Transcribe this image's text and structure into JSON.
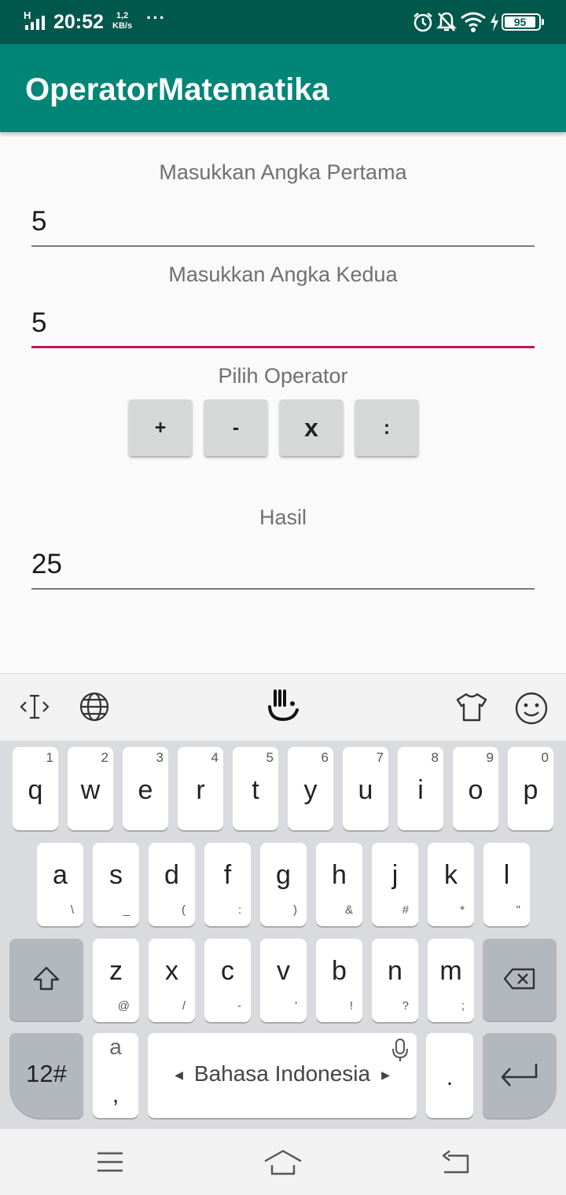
{
  "status_bar": {
    "network": "H",
    "time": "20:52",
    "speed_value": "1,2",
    "speed_unit": "KB/s",
    "more": "···",
    "battery": "95"
  },
  "app_bar": {
    "title": "OperatorMatematika"
  },
  "form": {
    "first_label": "Masukkan Angka Pertama",
    "first_value": "5",
    "second_label": "Masukkan Angka Kedua",
    "second_value": "5",
    "operator_label": "Pilih Operator",
    "operators": [
      "+",
      "-",
      "x",
      ":"
    ],
    "result_label": "Hasil",
    "result_value": "25"
  },
  "keyboard": {
    "toolbar_icons": [
      "cursor-icon",
      "globe-icon",
      "touchpal-logo-icon",
      "tshirt-theme-icon",
      "emoji-icon"
    ],
    "row1": [
      {
        "k": "q",
        "n": "1"
      },
      {
        "k": "w",
        "n": "2"
      },
      {
        "k": "e",
        "n": "3"
      },
      {
        "k": "r",
        "n": "4"
      },
      {
        "k": "t",
        "n": "5"
      },
      {
        "k": "y",
        "n": "6"
      },
      {
        "k": "u",
        "n": "7"
      },
      {
        "k": "i",
        "n": "8"
      },
      {
        "k": "o",
        "n": "9"
      },
      {
        "k": "p",
        "n": "0"
      }
    ],
    "row2": [
      {
        "k": "a",
        "s": "\\"
      },
      {
        "k": "s",
        "s": "_"
      },
      {
        "k": "d",
        "s": "("
      },
      {
        "k": "f",
        "s": ":"
      },
      {
        "k": "g",
        "s": ")"
      },
      {
        "k": "h",
        "s": "&"
      },
      {
        "k": "j",
        "s": "#"
      },
      {
        "k": "k",
        "s": "*"
      },
      {
        "k": "l",
        "s": "\""
      }
    ],
    "row3": [
      {
        "k": "z",
        "s": "@"
      },
      {
        "k": "x",
        "s": "/"
      },
      {
        "k": "c",
        "s": "-"
      },
      {
        "k": "v",
        "s": "'"
      },
      {
        "k": "b",
        "s": "!"
      },
      {
        "k": "n",
        "s": "?"
      },
      {
        "k": "m",
        "s": ";"
      }
    ],
    "symbols_key": "12#",
    "comma_key_top": "a",
    "comma_key_bottom": ",",
    "space_label": "Bahasa Indonesia",
    "period_key": "."
  },
  "colors": {
    "status_bar": "#00574b",
    "app_bar": "#008577",
    "accent": "#c2185b"
  }
}
